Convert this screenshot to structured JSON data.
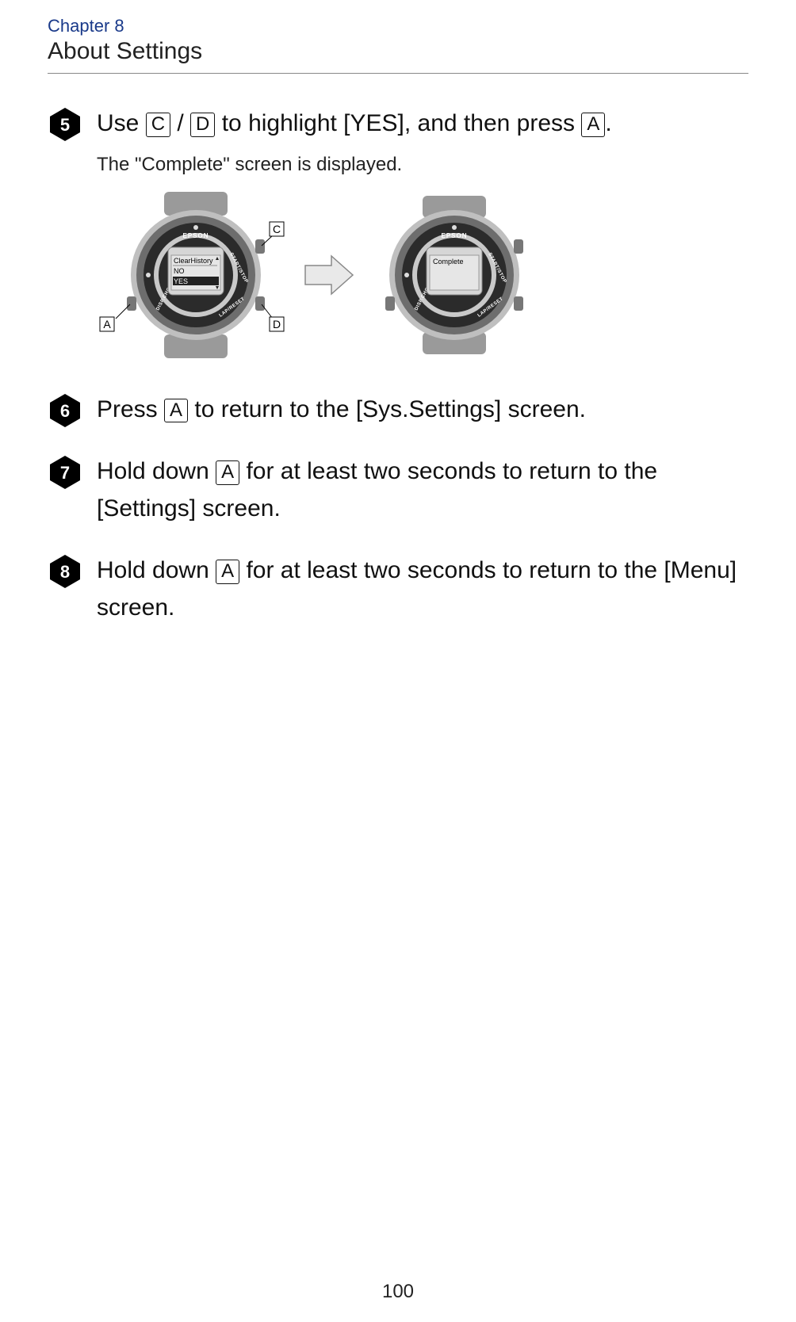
{
  "header": {
    "chapter": "Chapter 8",
    "section": "About Settings"
  },
  "steps": {
    "s5": {
      "num": "5",
      "heading_parts": {
        "t1": "Use ",
        "key1": "C",
        "t2": " / ",
        "key2": "D",
        "t3": " to highlight [YES], and then press ",
        "key3": "A",
        "t4": "."
      },
      "subtext": "The \"Complete\" screen is displayed.",
      "figure": {
        "watch1": {
          "brand": "EPSON",
          "screen_line1": "ClearHistory",
          "screen_line2": "NO",
          "screen_line3": "YES",
          "label_top_right": "C",
          "label_bottom_right": "D",
          "label_bottom_left": "A",
          "bezel_right": "START/STOP",
          "bezel_left": "DISP.CHG",
          "bezel_bottom": "LAP/RESET"
        },
        "watch2": {
          "brand": "EPSON",
          "screen_line1": "Complete",
          "bezel_right": "START/STOP",
          "bezel_left": "DISP.CHG",
          "bezel_bottom": "LAP/RESET"
        }
      }
    },
    "s6": {
      "num": "6",
      "heading_parts": {
        "t1": "Press ",
        "key1": "A",
        "t2": " to return to the [Sys.Settings] screen."
      }
    },
    "s7": {
      "num": "7",
      "heading_parts": {
        "t1": "Hold down ",
        "key1": "A",
        "t2": " for at least two seconds to return to the [Settings] screen."
      }
    },
    "s8": {
      "num": "8",
      "heading_parts": {
        "t1": "Hold down ",
        "key1": "A",
        "t2": " for at least two seconds to return to the [Menu] screen."
      }
    }
  },
  "page_number": "100"
}
